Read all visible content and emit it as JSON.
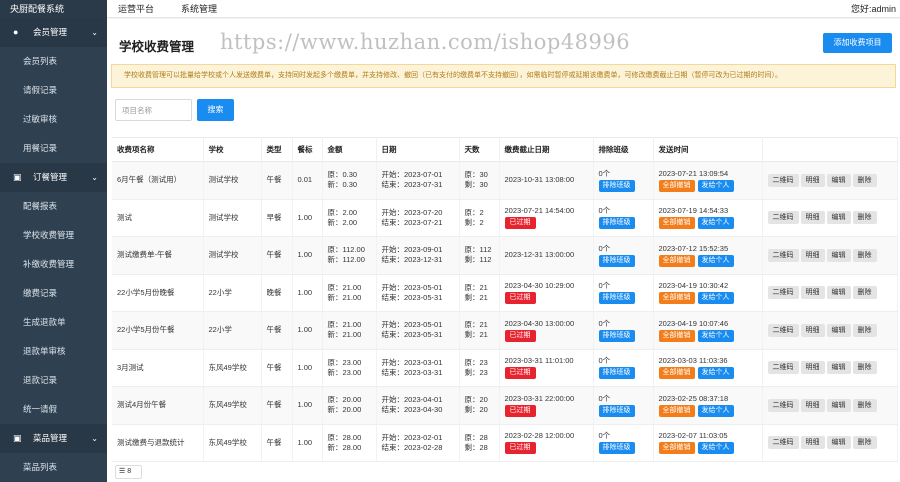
{
  "sidebar": {
    "brand": "央厨配餐系统",
    "groups": [
      {
        "label": "会员管理",
        "icon": "user-icon",
        "items": [
          "会员列表",
          "请假记录",
          "过敏审核",
          "用餐记录"
        ]
      },
      {
        "label": "订餐管理",
        "icon": "cart-icon",
        "items": [
          "配餐报表",
          "学校收费管理",
          "补缴收费管理",
          "缴费记录",
          "生成退款单",
          "退款单审核",
          "退款记录",
          "统一请假"
        ]
      },
      {
        "label": "菜品管理",
        "icon": "cart-icon",
        "items": [
          "菜品列表"
        ]
      }
    ]
  },
  "topbar": {
    "nav": [
      "运营平台",
      "系统管理"
    ],
    "user": "您好:admin"
  },
  "page": {
    "title": "学校收费管理",
    "watermark": "https://www.huzhan.com/ishop48996",
    "add_button": "添加收费项目",
    "notice": "学校收费管理可以批量给学校或个人发送缴费单，支持同时发起多个缴费单，并支持修改、撤回（已有支付的缴费单不支持撤回），如需临时暂停或延期该缴费单，可修改缴费截止日期（暂停可改为已过期的时间）。",
    "search_placeholder": "项目名称",
    "search_button": "搜索",
    "pager_text": "8"
  },
  "table": {
    "headers": [
      "收费项名称",
      "学校",
      "类型",
      "餐标",
      "金额",
      "日期",
      "天数",
      "缴费截止日期",
      "排除班级",
      "发送时间",
      ""
    ],
    "expired_label": "已过期",
    "exclude_button": "排除班级",
    "withdraw_button": "全部撤销",
    "send_button": "发给个人",
    "ops": [
      "二维码",
      "明细",
      "编辑",
      "删除"
    ],
    "rows": [
      {
        "name": "6月午餐（测试用）",
        "school": "测试学校",
        "type": "午餐",
        "std": "0.01",
        "amt1": "原：0.30",
        "amt2": "新：0.30",
        "d1": "开始：2023-07-01",
        "d2": "结束：2023-07-31",
        "days1": "原：30",
        "days2": "剩：30",
        "deadline": "2023-10-31 13:08:00",
        "expired": false,
        "excl": "0个",
        "sent": "2023-07-21 13:09:54"
      },
      {
        "name": "测试",
        "school": "测试学校",
        "type": "早餐",
        "std": "1.00",
        "amt1": "原：2.00",
        "amt2": "新：2.00",
        "d1": "开始：2023-07-20",
        "d2": "结束：2023-07-21",
        "days1": "原：2",
        "days2": "剩：2",
        "deadline": "2023-07-21 14:54:00",
        "expired": true,
        "excl": "0个",
        "sent": "2023-07-19 14:54:33"
      },
      {
        "name": "测试缴费单-午餐",
        "school": "测试学校",
        "type": "午餐",
        "std": "1.00",
        "amt1": "原：112.00",
        "amt2": "新：112.00",
        "d1": "开始：2023-09-01",
        "d2": "结束：2023-12-31",
        "days1": "原：112",
        "days2": "剩：112",
        "deadline": "2023-12-31 13:00:00",
        "expired": false,
        "excl": "0个",
        "sent": "2023-07-12 15:52:35"
      },
      {
        "name": "22小学5月份晚餐",
        "school": "22小学",
        "type": "晚餐",
        "std": "1.00",
        "amt1": "原：21.00",
        "amt2": "新：21.00",
        "d1": "开始：2023-05-01",
        "d2": "结束：2023-05-31",
        "days1": "原：21",
        "days2": "剩：21",
        "deadline": "2023-04-30 10:29:00",
        "expired": true,
        "excl": "0个",
        "sent": "2023-04-19 10:30:42"
      },
      {
        "name": "22小学5月份午餐",
        "school": "22小学",
        "type": "午餐",
        "std": "1.00",
        "amt1": "原：21.00",
        "amt2": "新：21.00",
        "d1": "开始：2023-05-01",
        "d2": "结束：2023-05-31",
        "days1": "原：21",
        "days2": "剩：21",
        "deadline": "2023-04-30 13:00:00",
        "expired": true,
        "excl": "0个",
        "sent": "2023-04-19 10:07:46"
      },
      {
        "name": "3月测试",
        "school": "东风49学校",
        "type": "午餐",
        "std": "1.00",
        "amt1": "原：23.00",
        "amt2": "新：23.00",
        "d1": "开始：2023-03-01",
        "d2": "结束：2023-03-31",
        "days1": "原：23",
        "days2": "剩：23",
        "deadline": "2023-03-31 11:01:00",
        "expired": true,
        "excl": "0个",
        "sent": "2023-03-03 11:03:36"
      },
      {
        "name": "测试4月份午餐",
        "school": "东风49学校",
        "type": "午餐",
        "std": "1.00",
        "amt1": "原：20.00",
        "amt2": "新：20.00",
        "d1": "开始：2023-04-01",
        "d2": "结束：2023-04-30",
        "days1": "原：20",
        "days2": "剩：20",
        "deadline": "2023-03-31 22:00:00",
        "expired": true,
        "excl": "0个",
        "sent": "2023-02-25 08:37:18"
      },
      {
        "name": "测试缴费与退款统计",
        "school": "东风49学校",
        "type": "午餐",
        "std": "1.00",
        "amt1": "原：28.00",
        "amt2": "新：28.00",
        "d1": "开始：2023-02-01",
        "d2": "结束：2023-02-28",
        "days1": "原：28",
        "days2": "剩：28",
        "deadline": "2023-02-28 12:00:00",
        "expired": true,
        "excl": "0个",
        "sent": "2023-02-07 11:03:05"
      }
    ]
  },
  "colors": {
    "sidebar": "#2f4050",
    "primary": "#1a8cf0",
    "danger": "#e7232f",
    "warning": "#f27d1a",
    "notice_bg": "#fdf3d9"
  }
}
